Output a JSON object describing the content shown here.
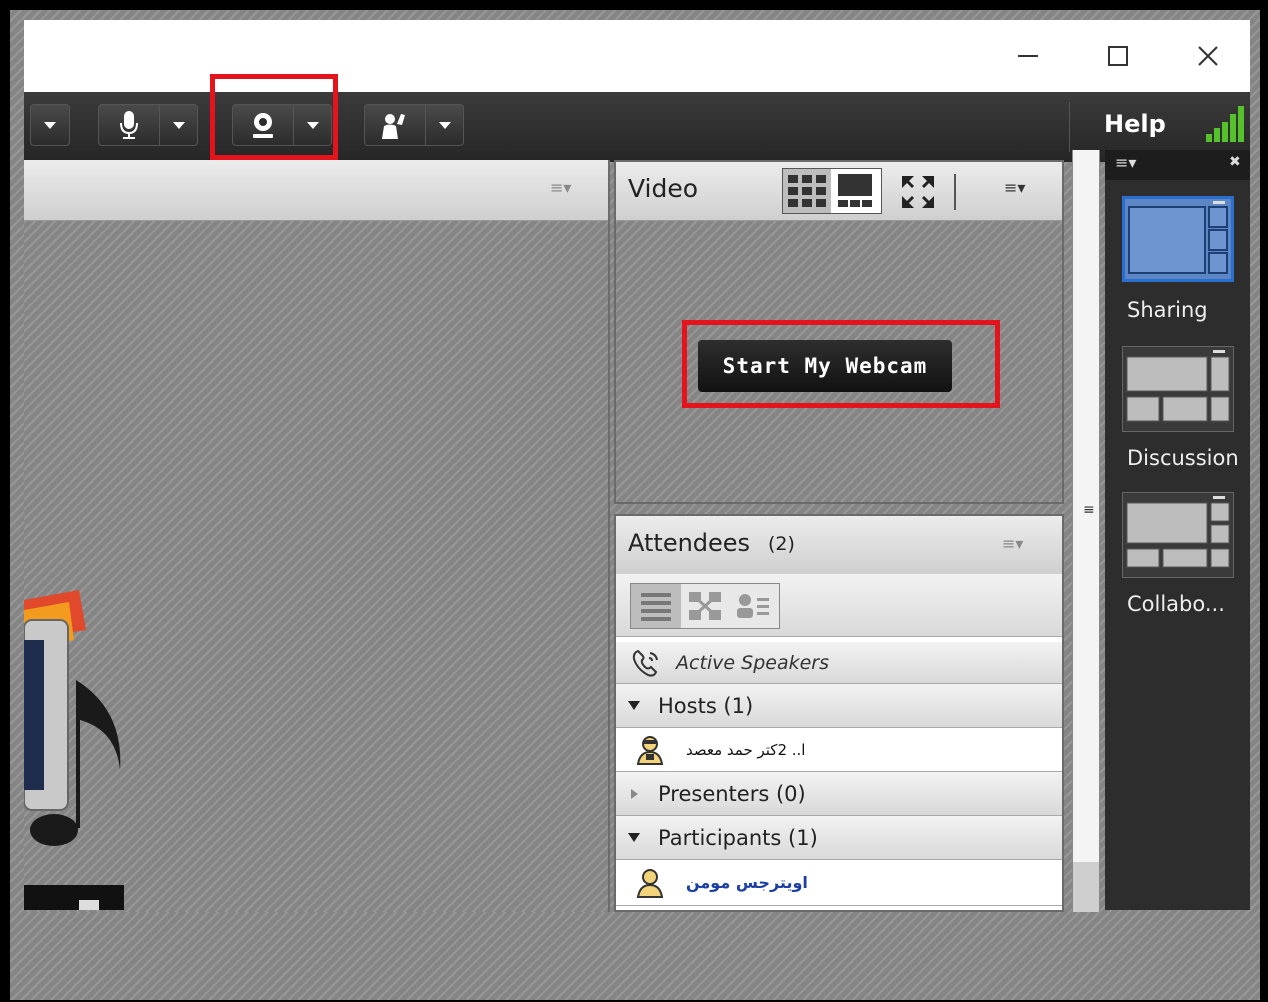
{
  "window": {
    "minimize_icon": "minimize-icon",
    "maximize_icon": "maximize-icon",
    "close_icon": "close-icon"
  },
  "toolbar": {
    "help_label": "Help",
    "icons": [
      "microphone-icon",
      "webcam-icon",
      "raise-hand-icon",
      "signal-bars-icon"
    ]
  },
  "share_pod": {
    "menu_icon": "≡▾"
  },
  "video_pod": {
    "title": "Video",
    "start_webcam_label": "Start My Webcam",
    "menu_icon": "≡▾"
  },
  "attendees_pod": {
    "title": "Attendees",
    "count": "(2)",
    "menu_icon": "≡▾",
    "active_speakers": "Active Speakers",
    "hosts_label": "Hosts (1)",
    "host_name": "ا.. 2کتر حمد معصد",
    "presenters_label": "Presenters (0)",
    "participants_label": "Participants (1)",
    "participant_name": "اویترجس مومن"
  },
  "layouts_rail": {
    "menu_icon": "≡▾",
    "close_icon": "✖",
    "items": [
      {
        "label": "Sharing"
      },
      {
        "label": "Discussion"
      },
      {
        "label": "Collabo..."
      }
    ]
  },
  "colors": {
    "highlight_red": "#e3141b",
    "toolbar_dark": "#2e2e2e",
    "signal_green": "#55c22b",
    "selected_blue": "#2a6fd0",
    "name_blue": "#1b3fa6"
  }
}
